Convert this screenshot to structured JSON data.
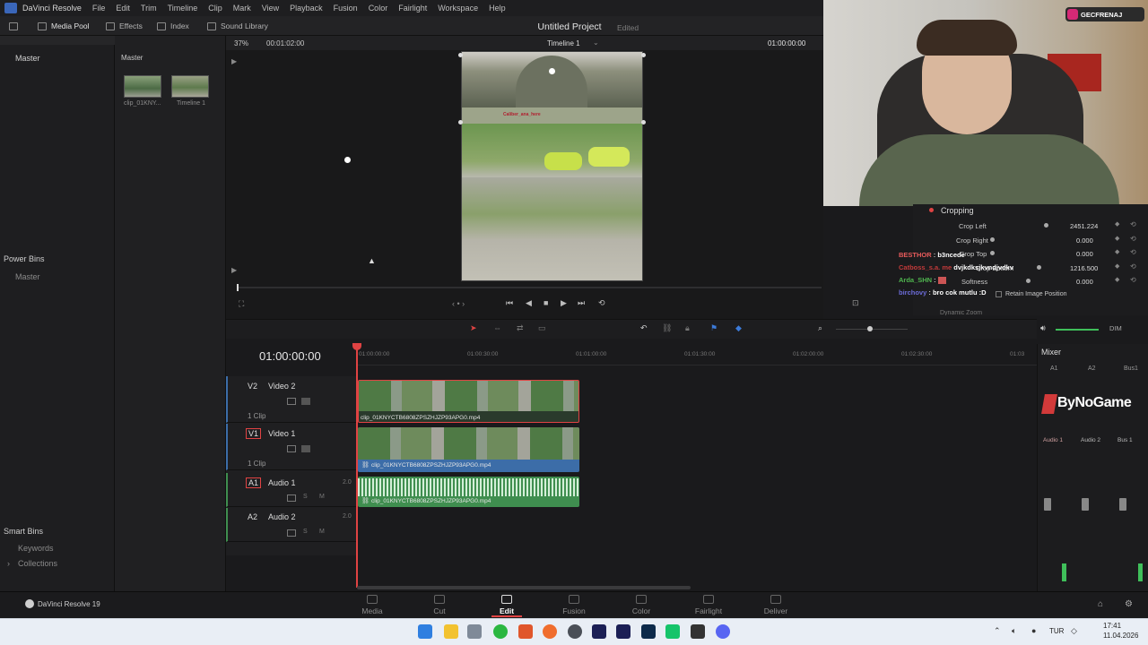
{
  "menubar": {
    "app_name": "DaVinci Resolve",
    "items": [
      "File",
      "Edit",
      "Trim",
      "Timeline",
      "Clip",
      "Mark",
      "View",
      "Playback",
      "Fusion",
      "Color",
      "Fairlight",
      "Workspace",
      "Help"
    ]
  },
  "toolbar": {
    "media_pool": "Media Pool",
    "effects": "Effects",
    "index": "Index",
    "sound_library": "Sound Library"
  },
  "project": {
    "title": "Untitled Project",
    "status": "Edited"
  },
  "left_panel": {
    "master": "Master",
    "power_bins": "Power Bins",
    "power_master": "Master",
    "smart_bins": "Smart Bins",
    "keywords": "Keywords",
    "collections": "Collections"
  },
  "media_pool": {
    "header": "Master",
    "items": [
      {
        "label": "clip_01KNY...",
        "kind": "clip"
      },
      {
        "label": "Timeline 1",
        "kind": "timeline"
      }
    ]
  },
  "viewer": {
    "zoom": "37%",
    "source_timecode": "00:01:02:00",
    "timeline_name": "Timeline 1",
    "record_timecode": "01:00:00:00",
    "overlay_caption": "Caliber_ana_here"
  },
  "webcam": {
    "social_handle": "GECFRENAJ"
  },
  "inspector": {
    "section": "Cropping",
    "rows": [
      {
        "label": "Crop Left",
        "value": "2451.224"
      },
      {
        "label": "Crop Right",
        "value": "0.000"
      },
      {
        "label": "Crop Top",
        "value": "0.000"
      },
      {
        "label": "Crop Bottom",
        "value": "1216.500"
      },
      {
        "label": "Softness",
        "value": "0.000"
      }
    ],
    "retain": "Retain Image Position",
    "next_section": "Dynamic Zoom"
  },
  "chat": [
    {
      "user": "BESTHOR",
      "msg": "b3ncede",
      "color": "#e85b5b"
    },
    {
      "user": "Catboss_s.a. me",
      "msg": "dvjkdksjkvndjvdkv",
      "color": "#c23a3a"
    },
    {
      "user": "Arda_SHN",
      "msg": "",
      "color": "#4fb54f"
    },
    {
      "user": "birchovy",
      "msg": "bro cok mutlu :D",
      "color": "#6c6cd9"
    }
  ],
  "timeline": {
    "timecode": "01:00:00:00",
    "ruler": [
      "01:00:00:00",
      "01:00:30:00",
      "01:01:00:00",
      "01:01:30:00",
      "01:02:00:00",
      "01:02:30:00",
      "01:03"
    ],
    "tracks": [
      {
        "id": "V2",
        "name": "Video 2",
        "sub": "1 Clip"
      },
      {
        "id": "V1",
        "name": "Video 1",
        "sub": "1 Clip"
      },
      {
        "id": "A1",
        "name": "Audio 1",
        "sub": "2.0"
      },
      {
        "id": "A2",
        "name": "Audio 2",
        "sub": "2.0"
      }
    ],
    "clip_name": "clip_01KNYCTB6808ZPSZHJZP93APG0.mp4"
  },
  "mixer": {
    "title": "Mixer",
    "cols": [
      "A1",
      "A2",
      "Bus1"
    ],
    "channel_labels": [
      "Audio 1",
      "Audio 2",
      "Bus 1"
    ],
    "brand": "ByNoGame",
    "dim": "DIM"
  },
  "pages": {
    "brand": "DaVinci Resolve 19",
    "items": [
      "Media",
      "Cut",
      "Edit",
      "Fusion",
      "Color",
      "Fairlight",
      "Deliver"
    ],
    "active": "Edit"
  },
  "taskbar": {
    "lang": "TUR",
    "time": "17:41",
    "date": "11.04.2026"
  },
  "colors": {
    "accent_red": "#e04343",
    "clip_video": "#3f6f4a",
    "clip_audio": "#3f8e4f",
    "clip_label_blue": "#3c6da8"
  }
}
